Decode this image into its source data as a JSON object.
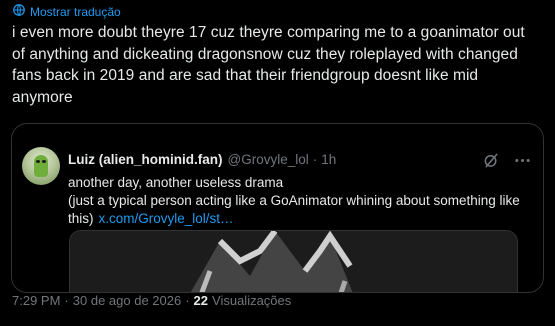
{
  "translate": {
    "label": "Mostrar tradução"
  },
  "post": {
    "text": "i even more doubt theyre 17 cuz theyre comparing me to a goanimator out of anything and dickeating dragonsnow cuz they roleplayed with changed fans back in 2019 and are sad that their friendgroup doesnt like mid anymore"
  },
  "quote": {
    "name": "Luiz (alien_hominid.fan)",
    "handle": "@Grovyle_lol",
    "dot": "·",
    "time": "1h",
    "line1": "another day, another useless drama",
    "line2": "(just a typical person acting like a GoAnimator whining about something like this)",
    "link": "x.com/Grovyle_lol/st…"
  },
  "footer": {
    "time": "7:29 PM",
    "dot1": "·",
    "date": "30 de ago de 2026",
    "dot2": "·",
    "views_count": "22",
    "views_label": "Visualizações"
  },
  "colors": {
    "accent": "#1d9bf0",
    "muted": "#71767b",
    "text": "#e7e9ea",
    "border": "#2f3336",
    "background": "#000000"
  },
  "icons": {
    "translate": "translate-globe-icon",
    "grok": "grok-slash-icon",
    "more": "more-dots-icon"
  }
}
